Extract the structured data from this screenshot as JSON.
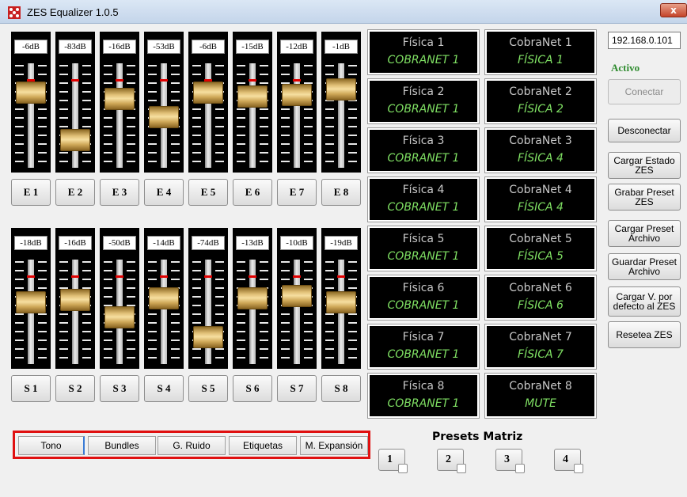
{
  "window": {
    "title": "ZES Equalizer 1.0.5",
    "close_label": "x"
  },
  "entradas": [
    {
      "db": "-6dB",
      "label": "E 1",
      "level": 0.78
    },
    {
      "db": "-83dB",
      "label": "E 2",
      "level": 0.2
    },
    {
      "db": "-16dB",
      "label": "E 3",
      "level": 0.7
    },
    {
      "db": "-53dB",
      "label": "E 4",
      "level": 0.48
    },
    {
      "db": "-6dB",
      "label": "E 5",
      "level": 0.78
    },
    {
      "db": "-15dB",
      "label": "E 6",
      "level": 0.73
    },
    {
      "db": "-12dB",
      "label": "E 7",
      "level": 0.75
    },
    {
      "db": "-1dB",
      "label": "E 8",
      "level": 0.82
    }
  ],
  "salidas": [
    {
      "db": "-18dB",
      "label": "S 1",
      "level": 0.62
    },
    {
      "db": "-16dB",
      "label": "S 2",
      "level": 0.64
    },
    {
      "db": "-50dB",
      "label": "S 3",
      "level": 0.43
    },
    {
      "db": "-14dB",
      "label": "S 4",
      "level": 0.66
    },
    {
      "db": "-74dB",
      "label": "S 5",
      "level": 0.19
    },
    {
      "db": "-13dB",
      "label": "S 6",
      "level": 0.66
    },
    {
      "db": "-10dB",
      "label": "S 7",
      "level": 0.69
    },
    {
      "db": "-19dB",
      "label": "S 8",
      "level": 0.62
    }
  ],
  "matrix_fisica": [
    {
      "name": "Física 1",
      "source": "COBRANET 1"
    },
    {
      "name": "Física 2",
      "source": "COBRANET 1"
    },
    {
      "name": "Física 3",
      "source": "COBRANET 1"
    },
    {
      "name": "Física 4",
      "source": "COBRANET 1"
    },
    {
      "name": "Física 5",
      "source": "COBRANET 1"
    },
    {
      "name": "Física 6",
      "source": "COBRANET 1"
    },
    {
      "name": "Física 7",
      "source": "COBRANET 1"
    },
    {
      "name": "Física 8",
      "source": "COBRANET 1"
    }
  ],
  "matrix_cobranet": [
    {
      "name": "CobraNet 1",
      "source": "FÍSICA 1"
    },
    {
      "name": "CobraNet 2",
      "source": "FÍSICA 2"
    },
    {
      "name": "CobraNet 3",
      "source": "FÍSICA 4"
    },
    {
      "name": "CobraNet 4",
      "source": "FÍSICA 4"
    },
    {
      "name": "CobraNet 5",
      "source": "FÍSICA 5"
    },
    {
      "name": "CobraNet 6",
      "source": "FÍSICA 6"
    },
    {
      "name": "CobraNet 7",
      "source": "FÍSICA 7"
    },
    {
      "name": "CobraNet 8",
      "source": "MUTE"
    }
  ],
  "connection": {
    "ip": "192.168.0.101",
    "status": "Activo"
  },
  "actions": {
    "conectar": "Conectar",
    "desconectar": "Desconectar",
    "cargar_estado": [
      "Cargar Estado",
      "ZES"
    ],
    "grabar_preset": [
      "Grabar Preset",
      "ZES"
    ],
    "cargar_preset_archivo": [
      "Cargar Preset",
      "Archivo"
    ],
    "guardar_preset_archivo": [
      "Guardar Preset",
      "Archivo"
    ],
    "cargar_defecto": [
      "Cargar V. por",
      "defecto al ZES"
    ],
    "resetea": "Resetea ZES"
  },
  "tabs": [
    "Tono",
    "Bundles",
    "G. Ruido",
    "Etiquetas",
    "M. Expansión"
  ],
  "presets": {
    "title": "Presets Matriz",
    "buttons": [
      "1",
      "2",
      "3",
      "4"
    ]
  },
  "colors": {
    "accent_red": "#e01010",
    "status_green": "#2e8b2e",
    "route_green": "#7fe063"
  }
}
